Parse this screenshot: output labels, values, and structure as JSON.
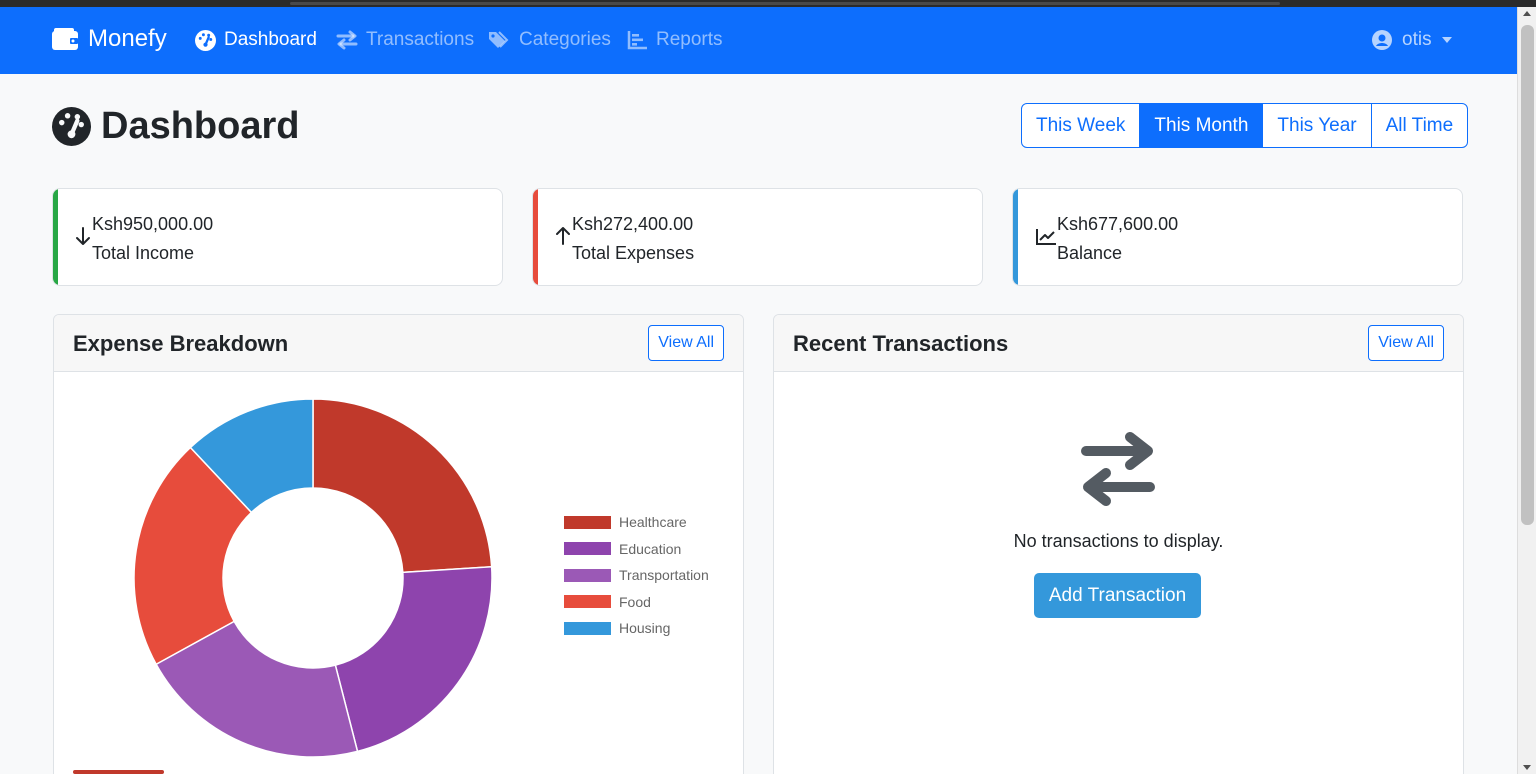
{
  "app": {
    "brand": "Monefy"
  },
  "nav": {
    "items": [
      {
        "label": "Dashboard",
        "active": true
      },
      {
        "label": "Transactions",
        "active": false
      },
      {
        "label": "Categories",
        "active": false
      },
      {
        "label": "Reports",
        "active": false
      }
    ],
    "user": "otis"
  },
  "header": {
    "title": "Dashboard",
    "periods": [
      "This Week",
      "This Month",
      "This Year",
      "All Time"
    ],
    "active_period": "This Month"
  },
  "stats": [
    {
      "amount": "Ksh950,000.00",
      "label": "Total Income",
      "color": "#28a745",
      "icon": "arrow-down-icon"
    },
    {
      "amount": "Ksh272,400.00",
      "label": "Total Expenses",
      "color": "#e74c3c",
      "icon": "arrow-up-icon"
    },
    {
      "amount": "Ksh677,600.00",
      "label": "Balance",
      "color": "#3498db",
      "icon": "chart-line-icon"
    }
  ],
  "expense_panel": {
    "title": "Expense Breakdown",
    "view_all": "View All"
  },
  "transactions_panel": {
    "title": "Recent Transactions",
    "view_all": "View All",
    "empty_text": "No transactions to display.",
    "add_button": "Add Transaction"
  },
  "chart_data": {
    "type": "pie",
    "donut": true,
    "categories": [
      "Healthcare",
      "Education",
      "Transportation",
      "Food",
      "Housing"
    ],
    "values": [
      24,
      22,
      21,
      21,
      12
    ],
    "colors": [
      "#c0392b",
      "#8e44ad",
      "#9b59b6",
      "#e74c3c",
      "#3498db"
    ],
    "legend": "right"
  }
}
